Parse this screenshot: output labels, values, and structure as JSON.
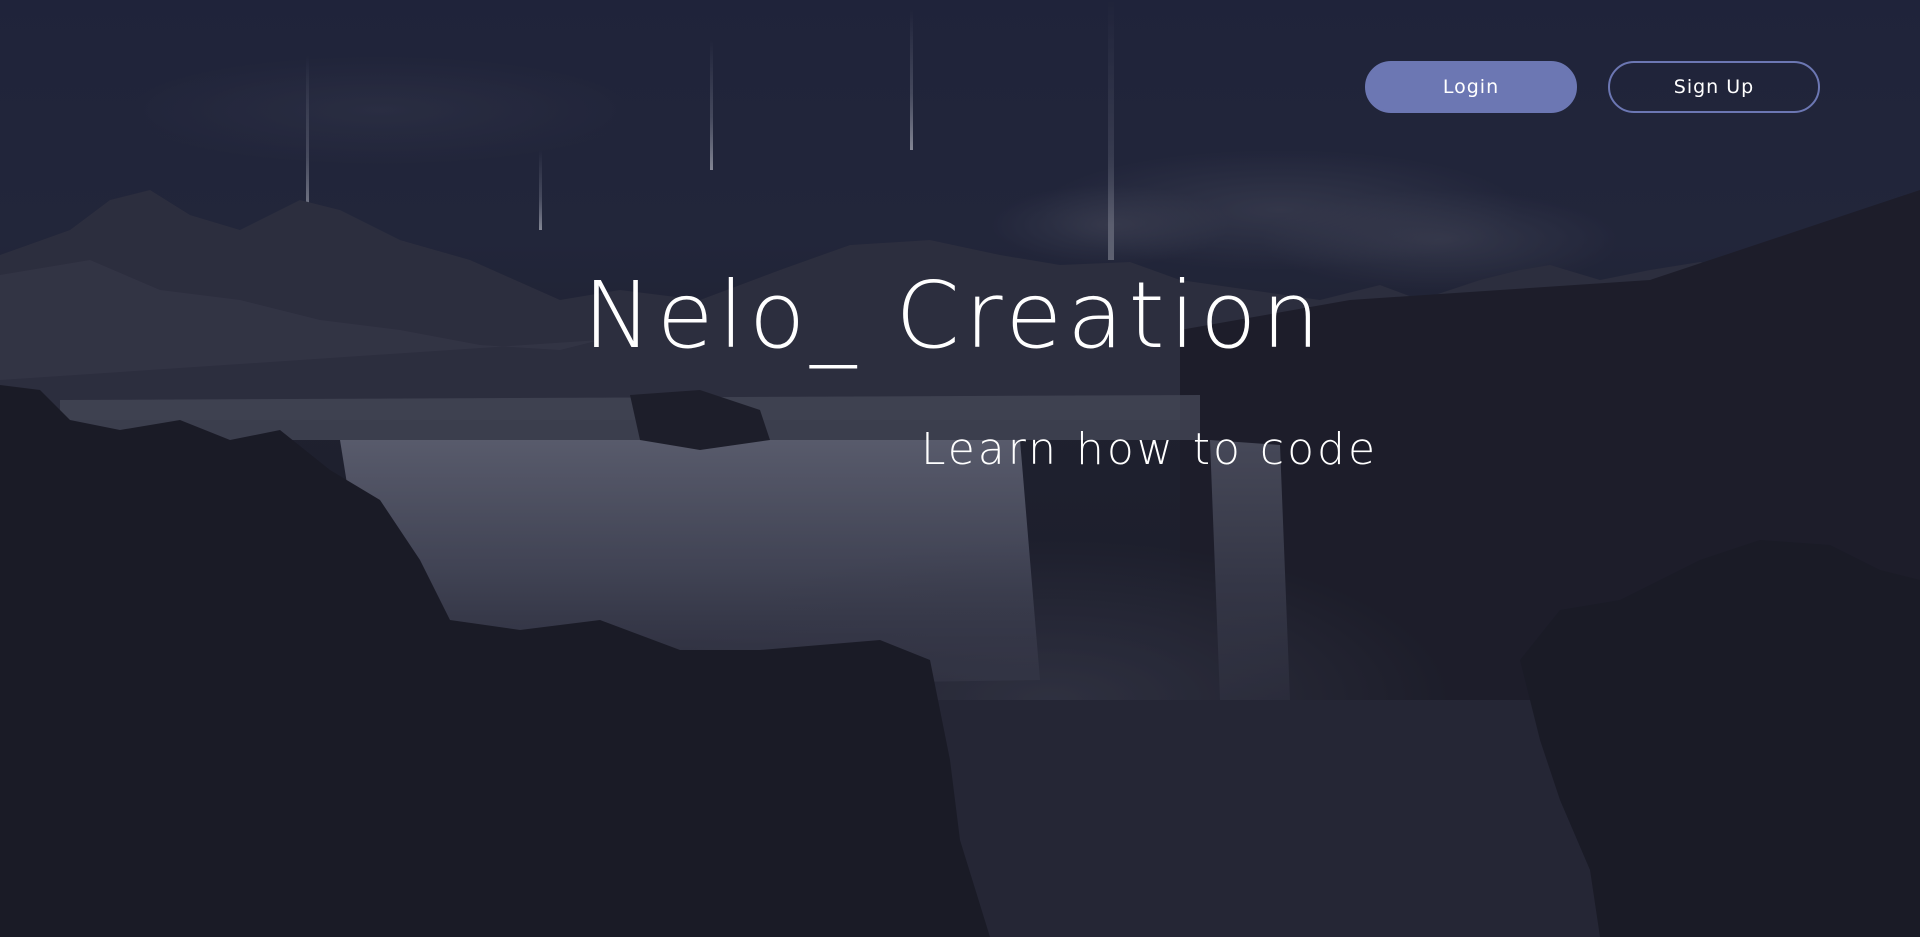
{
  "header": {
    "login_label": "Login",
    "signup_label": "Sign Up"
  },
  "hero": {
    "title": "Nelo_ Creation",
    "subtitle": "Learn how to code"
  },
  "colors": {
    "accent": "#6c77b3",
    "text": "#ffffff",
    "overlay": "#1b1c2b"
  }
}
